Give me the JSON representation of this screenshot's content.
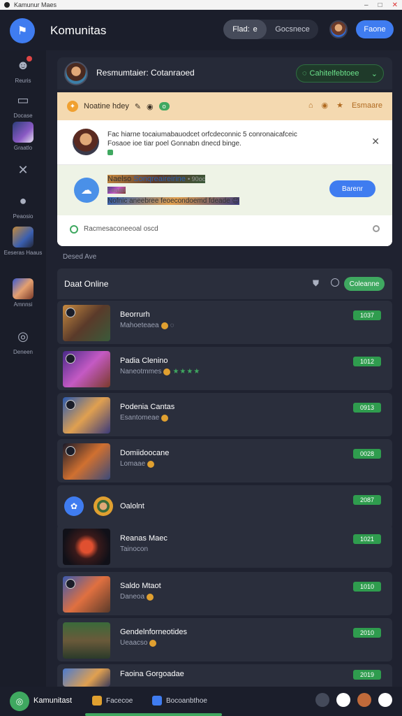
{
  "window": {
    "title": "Kamunur Maes"
  },
  "header": {
    "app_title": "Komunitas",
    "seg_active": "Flad:",
    "seg_active_icon": "e",
    "seg_inactive": "Gocsnece",
    "button": "Faone"
  },
  "sidebar": {
    "items": [
      {
        "label": "Reuris",
        "icon": "people-icon"
      },
      {
        "label": "Docase",
        "icon": "folder-icon"
      },
      {
        "label": "Graatlo",
        "icon": "game-thumb"
      },
      {
        "label": "",
        "icon": "tools-icon"
      },
      {
        "label": "Peaosio",
        "icon": "user-icon"
      },
      {
        "label": "Eeseras Haaus",
        "icon": "game-thumb"
      },
      {
        "label": "Amnnsi",
        "icon": "game-thumb"
      },
      {
        "label": "Deneen",
        "icon": "search-icon"
      }
    ]
  },
  "profile_bar": {
    "name": "Resmumtaier: Cotanraoed",
    "status": "Cahitelfebtoee"
  },
  "notification": {
    "header": "Noatine hdey",
    "header_tag": "o",
    "header_right": "Esmaare",
    "item1_line1": "Fac hiarne tocaiumabauodcet orfcdeconnic 5 conronaicafceic",
    "item1_line2": "Fosaoe ioe tiar poel Gonnabn dnecd binge.",
    "item2_title": "Naelso",
    "item2_link": "Sonqreaireirine",
    "item2_small": "• 90oc",
    "item2_line2": "Faaao",
    "item2_line3": "Nofnic aneebree feoecondoemd fdeade",
    "item2_button": "Barenr",
    "item3_text": "Racmesaconeeoal oscd"
  },
  "section_label": "Desed Ave",
  "online": {
    "title": "Daat Online",
    "button": "Coleanne"
  },
  "games": [
    {
      "name": "Beorrurh",
      "sub": "Mahoeteaea",
      "tag": "1037"
    },
    {
      "name": "Padia Clenino",
      "sub": "Naneotmmes",
      "tag": "1012"
    },
    {
      "name": "Podenia Cantas",
      "sub": "Esantomeae",
      "tag": "0913"
    },
    {
      "name": "Domiidoocane",
      "sub": "Lomaae",
      "tag": "0028"
    },
    {
      "name": "Oalolnt",
      "sub": "",
      "tag": "2087"
    },
    {
      "name": "Reanas Maec",
      "sub": "Tainocon",
      "tag": "1021"
    },
    {
      "name": "Saldo Mtaot",
      "sub": "Daneoa",
      "tag": "1010"
    },
    {
      "name": "Gendelnforneotides",
      "sub": "Ueaacso",
      "tag": "2010"
    },
    {
      "name": "Faoina Gorgoadae",
      "sub": "",
      "tag": "2019"
    }
  ],
  "bottombar": {
    "title": "Kamunitast",
    "item1": "Facecoe",
    "item2": "Bocoanbthoe"
  },
  "colors": {
    "accent_blue": "#3f7cf0",
    "accent_green": "#3fa860",
    "background": "#1f2230"
  }
}
